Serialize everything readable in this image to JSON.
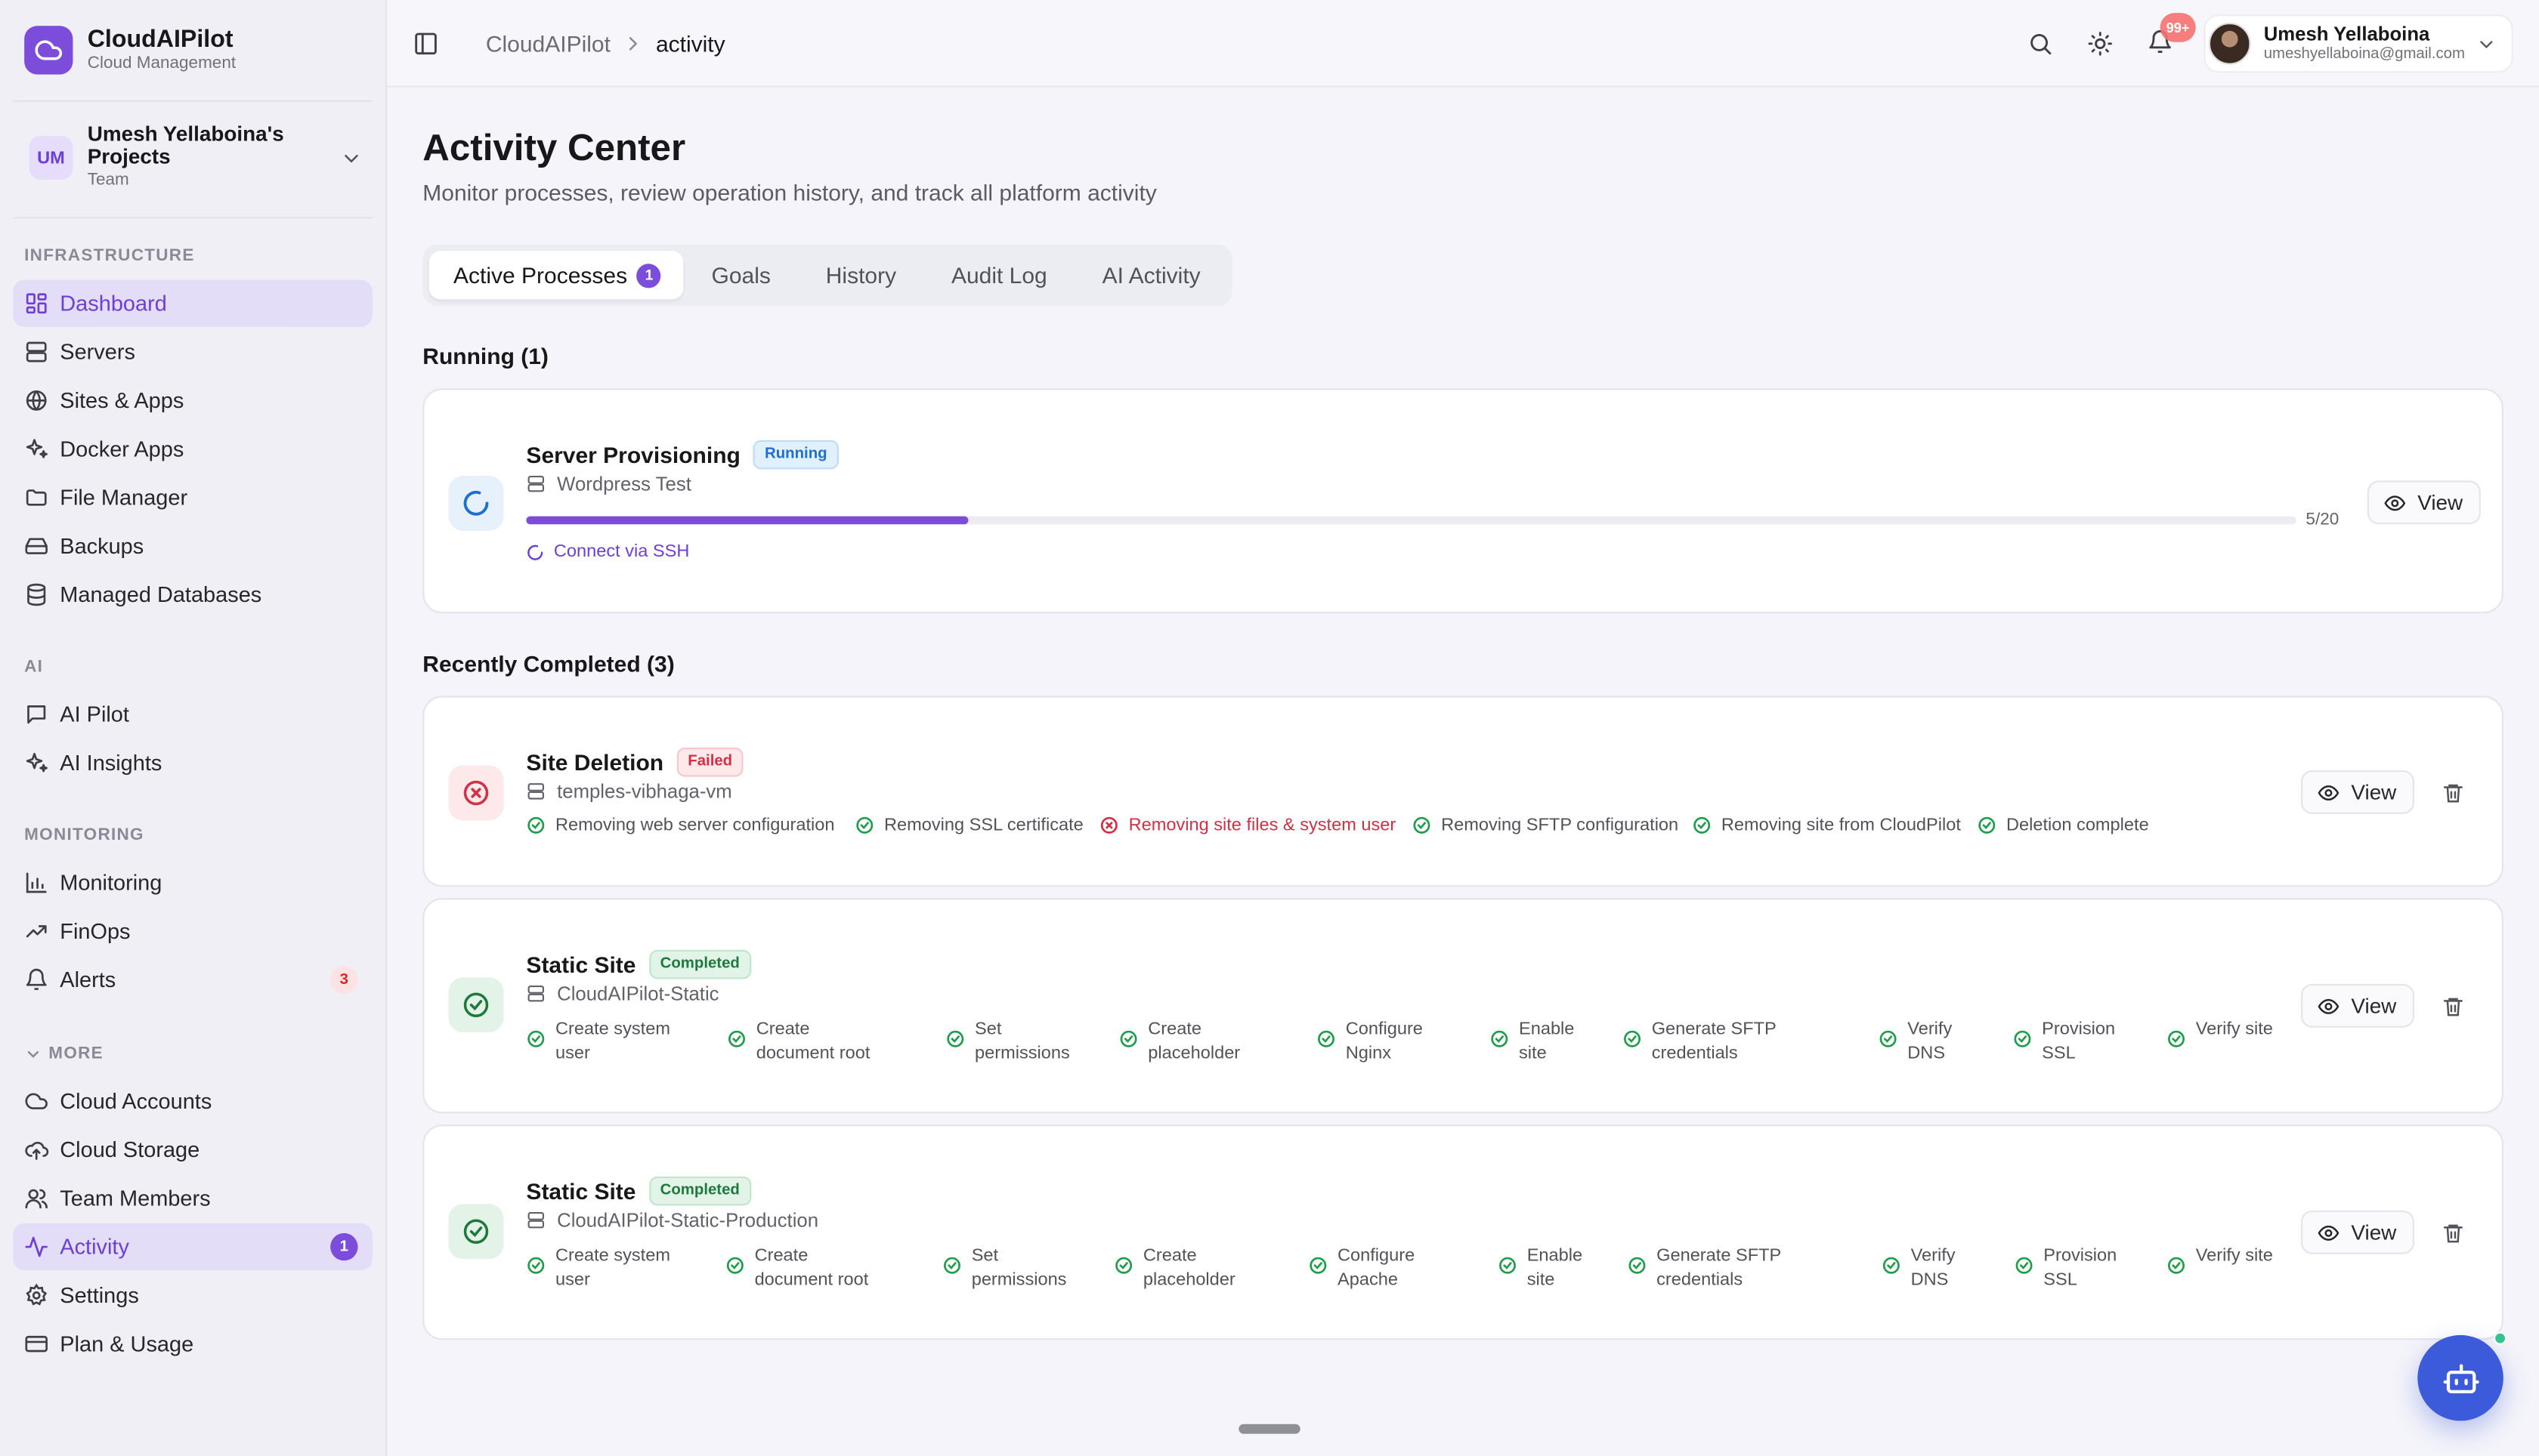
{
  "brand": {
    "name": "CloudAIPilot",
    "subtitle": "Cloud Management"
  },
  "team": {
    "initials": "UM",
    "name": "Umesh Yellaboina's Projects",
    "role": "Team"
  },
  "sidebar": {
    "sections": {
      "infrastructure": "INFRASTRUCTURE",
      "ai": "AI",
      "monitoring": "MONITORING",
      "more": "MORE"
    },
    "items": {
      "dashboard": "Dashboard",
      "servers": "Servers",
      "sites": "Sites & Apps",
      "docker": "Docker Apps",
      "files": "File Manager",
      "backups": "Backups",
      "databases": "Managed Databases",
      "ai_pilot": "AI Pilot",
      "ai_insights": "AI Insights",
      "monitoring": "Monitoring",
      "finops": "FinOps",
      "alerts": "Alerts",
      "alerts_badge": "3",
      "cloud_accounts": "Cloud Accounts",
      "cloud_storage": "Cloud Storage",
      "team_members": "Team Members",
      "activity": "Activity",
      "activity_badge": "1",
      "settings": "Settings",
      "plan": "Plan & Usage"
    }
  },
  "header": {
    "breadcrumb_root": "CloudAIPilot",
    "breadcrumb_current": "activity",
    "notifications_badge": "99+",
    "user_name": "Umesh Yellaboina",
    "user_email": "umeshyellaboina@gmail.com"
  },
  "page": {
    "title": "Activity Center",
    "subtitle": "Monitor processes, review operation history, and track all platform activity"
  },
  "tabs": {
    "active": "Active Processes",
    "active_count": "1",
    "goals": "Goals",
    "history": "History",
    "audit": "Audit Log",
    "ai": "AI Activity"
  },
  "running": {
    "label": "Running (1)",
    "process": {
      "title": "Server Provisioning",
      "status": "Running",
      "target": "Wordpress Test",
      "progress": 0.25,
      "progress_text": "5/20",
      "current_step": "Connect via SSH",
      "view": "View"
    }
  },
  "completed": {
    "label": "Recently Completed (3)",
    "deletion": {
      "title": "Site Deletion",
      "status": "Failed",
      "target": "temples-vibhaga-vm",
      "view": "View",
      "steps": [
        "Removing web server configuration",
        "Removing SSL certificate",
        "Removing site files & system user",
        "Removing SFTP configuration",
        "Removing site from CloudPilot",
        "Deletion complete"
      ]
    },
    "static1": {
      "title": "Static Site",
      "status": "Completed",
      "target": "CloudAIPilot-Static",
      "view": "View",
      "steps": [
        "Create system user",
        "Create document root",
        "Set permissions",
        "Create placeholder",
        "Configure Nginx",
        "Enable site",
        "Generate SFTP credentials",
        "Verify DNS",
        "Provision SSL",
        "Verify site"
      ]
    },
    "static2": {
      "title": "Static Site",
      "status": "Completed",
      "target": "CloudAIPilot-Static-Production",
      "view": "View",
      "steps": [
        "Create system user",
        "Create document root",
        "Set permissions",
        "Create placeholder",
        "Configure Apache",
        "Enable site",
        "Generate SFTP credentials",
        "Verify DNS",
        "Provision SSL",
        "Verify site"
      ]
    }
  },
  "colors": {
    "accent": "#7c4ddb",
    "success": "#1e9e4a",
    "danger": "#d32f45",
    "info": "#1d6fd1"
  }
}
